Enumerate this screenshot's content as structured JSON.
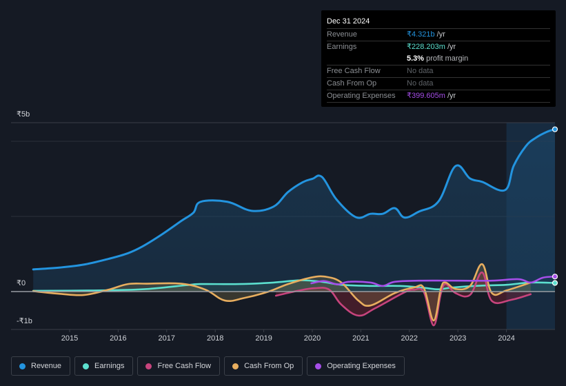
{
  "tooltip": {
    "date": "Dec 31 2024",
    "rows": [
      {
        "label": "Revenue",
        "value": "₹4.321b",
        "unit": "/yr",
        "color": "#2394df"
      },
      {
        "label": "Earnings",
        "value": "₹228.203m",
        "unit": "/yr",
        "color": "#5ce0cf"
      },
      {
        "label": "",
        "margin_value": "5.3%",
        "margin_text": "profit margin"
      },
      {
        "label": "Free Cash Flow",
        "value": "No data"
      },
      {
        "label": "Cash From Op",
        "value": "No data"
      },
      {
        "label": "Operating Expenses",
        "value": "₹399.605m",
        "unit": "/yr",
        "color": "#a54ee8"
      }
    ]
  },
  "legend": [
    {
      "label": "Revenue",
      "color": "#2394df"
    },
    {
      "label": "Earnings",
      "color": "#5ce0cf"
    },
    {
      "label": "Free Cash Flow",
      "color": "#c7447d"
    },
    {
      "label": "Cash From Op",
      "color": "#e8ae5f"
    },
    {
      "label": "Operating Expenses",
      "color": "#a54ee8"
    }
  ],
  "chart_data": {
    "type": "line",
    "title": "",
    "xlabel": "",
    "ylabel": "",
    "currency": "₹",
    "ylim": [
      -1,
      5
    ],
    "xlim": [
      2014.2,
      2025.0
    ],
    "yticks": [
      {
        "value": 5,
        "label": "₹5b"
      },
      {
        "value": 0,
        "label": "₹0"
      },
      {
        "value": -1,
        "label": "-₹1b"
      }
    ],
    "grid_values": [
      4,
      2
    ],
    "xticks": [
      2015,
      2016,
      2017,
      2018,
      2019,
      2020,
      2021,
      2022,
      2023,
      2024
    ],
    "highlight_from": 2024.0,
    "legend_position": "bottom-left",
    "series": [
      {
        "name": "Revenue",
        "color": "#2394df",
        "fill": true,
        "end_marker": true,
        "points": [
          [
            2014.25,
            0.59
          ],
          [
            2014.8,
            0.64
          ],
          [
            2015.3,
            0.72
          ],
          [
            2015.8,
            0.87
          ],
          [
            2016.2,
            1.02
          ],
          [
            2016.5,
            1.2
          ],
          [
            2016.9,
            1.52
          ],
          [
            2017.3,
            1.88
          ],
          [
            2017.55,
            2.1
          ],
          [
            2017.7,
            2.39
          ],
          [
            2018.25,
            2.39
          ],
          [
            2018.75,
            2.15
          ],
          [
            2019.2,
            2.26
          ],
          [
            2019.5,
            2.65
          ],
          [
            2019.8,
            2.91
          ],
          [
            2020.0,
            3.0
          ],
          [
            2020.2,
            3.05
          ],
          [
            2020.5,
            2.45
          ],
          [
            2020.9,
            1.98
          ],
          [
            2021.2,
            2.07
          ],
          [
            2021.45,
            2.07
          ],
          [
            2021.7,
            2.22
          ],
          [
            2021.9,
            1.97
          ],
          [
            2022.2,
            2.13
          ],
          [
            2022.6,
            2.4
          ],
          [
            2022.95,
            3.34
          ],
          [
            2023.25,
            3.01
          ],
          [
            2023.5,
            2.92
          ],
          [
            2023.97,
            2.7
          ],
          [
            2024.15,
            3.35
          ],
          [
            2024.4,
            3.87
          ],
          [
            2024.6,
            4.09
          ],
          [
            2024.83,
            4.25
          ],
          [
            2025.0,
            4.32
          ]
        ]
      },
      {
        "name": "Earnings",
        "color": "#5ce0cf",
        "fill": true,
        "end_marker": true,
        "points": [
          [
            2014.25,
            0.02
          ],
          [
            2015.5,
            0.03
          ],
          [
            2016.5,
            0.06
          ],
          [
            2017.4,
            0.17
          ],
          [
            2017.7,
            0.2
          ],
          [
            2018.5,
            0.2
          ],
          [
            2019.2,
            0.24
          ],
          [
            2019.75,
            0.3
          ],
          [
            2020.2,
            0.26
          ],
          [
            2020.6,
            0.18
          ],
          [
            2021.2,
            0.15
          ],
          [
            2021.8,
            0.15
          ],
          [
            2022.3,
            0.1
          ],
          [
            2022.6,
            0.06
          ],
          [
            2022.9,
            0.11
          ],
          [
            2023.5,
            0.16
          ],
          [
            2024.0,
            0.18
          ],
          [
            2024.5,
            0.24
          ],
          [
            2025.0,
            0.23
          ]
        ]
      },
      {
        "name": "Free Cash Flow",
        "color": "#c7447d",
        "fill": true,
        "end_marker": false,
        "points": [
          [
            2019.25,
            -0.11
          ],
          [
            2019.7,
            0.02
          ],
          [
            2020.05,
            0.09
          ],
          [
            2020.35,
            0.05
          ],
          [
            2020.6,
            -0.35
          ],
          [
            2020.95,
            -0.64
          ],
          [
            2021.3,
            -0.44
          ],
          [
            2021.9,
            -0.02
          ],
          [
            2022.1,
            0.05
          ],
          [
            2022.3,
            -0.02
          ],
          [
            2022.5,
            -0.9
          ],
          [
            2022.65,
            -0.05
          ],
          [
            2022.75,
            0.2
          ],
          [
            2022.95,
            -0.04
          ],
          [
            2023.25,
            -0.09
          ],
          [
            2023.5,
            0.51
          ],
          [
            2023.7,
            -0.25
          ],
          [
            2024.1,
            -0.22
          ],
          [
            2024.5,
            -0.07
          ]
        ]
      },
      {
        "name": "Cash From Op",
        "color": "#e8ae5f",
        "fill": true,
        "end_marker": false,
        "points": [
          [
            2014.25,
            0.01
          ],
          [
            2014.8,
            -0.06
          ],
          [
            2015.3,
            -0.09
          ],
          [
            2015.8,
            0.05
          ],
          [
            2016.2,
            0.2
          ],
          [
            2016.6,
            0.21
          ],
          [
            2017.3,
            0.21
          ],
          [
            2017.8,
            0.05
          ],
          [
            2018.2,
            -0.24
          ],
          [
            2018.6,
            -0.17
          ],
          [
            2019.1,
            0.0
          ],
          [
            2019.5,
            0.2
          ],
          [
            2020.0,
            0.38
          ],
          [
            2020.3,
            0.39
          ],
          [
            2020.6,
            0.24
          ],
          [
            2020.95,
            -0.24
          ],
          [
            2021.2,
            -0.37
          ],
          [
            2021.7,
            -0.04
          ],
          [
            2022.1,
            0.11
          ],
          [
            2022.3,
            0.09
          ],
          [
            2022.5,
            -0.77
          ],
          [
            2022.65,
            0.09
          ],
          [
            2022.75,
            0.24
          ],
          [
            2022.95,
            0.07
          ],
          [
            2023.25,
            0.15
          ],
          [
            2023.5,
            0.73
          ],
          [
            2023.7,
            -0.04
          ],
          [
            2024.0,
            0.03
          ],
          [
            2024.5,
            0.24
          ]
        ]
      },
      {
        "name": "Operating Expenses",
        "color": "#a54ee8",
        "fill": false,
        "end_marker": true,
        "points": [
          [
            2019.98,
            0.22
          ],
          [
            2020.25,
            0.28
          ],
          [
            2020.52,
            0.19
          ],
          [
            2020.75,
            0.26
          ],
          [
            2021.2,
            0.24
          ],
          [
            2021.45,
            0.15
          ],
          [
            2021.7,
            0.26
          ],
          [
            2022.2,
            0.29
          ],
          [
            2023.0,
            0.29
          ],
          [
            2023.7,
            0.29
          ],
          [
            2024.25,
            0.33
          ],
          [
            2024.5,
            0.24
          ],
          [
            2024.75,
            0.37
          ],
          [
            2025.0,
            0.4
          ]
        ]
      }
    ]
  }
}
